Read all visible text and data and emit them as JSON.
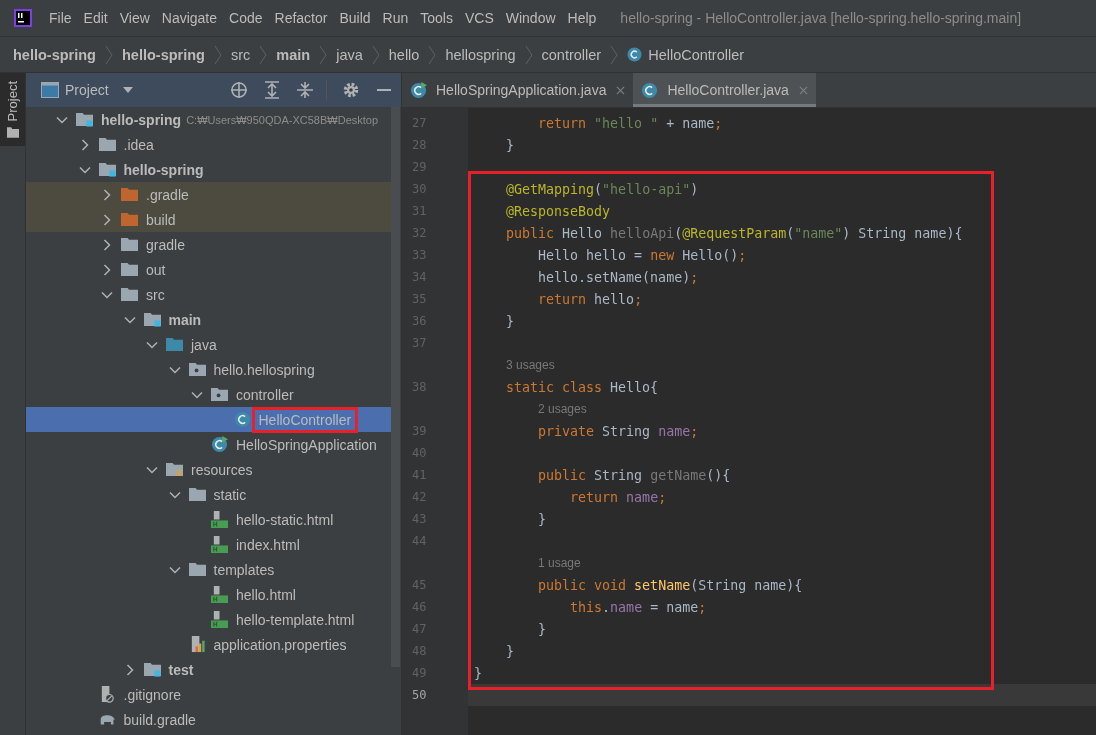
{
  "menu": [
    "File",
    "Edit",
    "View",
    "Navigate",
    "Code",
    "Refactor",
    "Build",
    "Run",
    "Tools",
    "VCS",
    "Window",
    "Help"
  ],
  "window": {
    "title": "hello-spring - HelloController.java [hello-spring.hello-spring.main]"
  },
  "breadcrumb": [
    {
      "label": "hello-spring",
      "bold": true
    },
    {
      "label": "hello-spring",
      "bold": true
    },
    {
      "label": "src",
      "bold": false
    },
    {
      "label": "main",
      "bold": true
    },
    {
      "label": "java",
      "bold": false
    },
    {
      "label": "hello",
      "bold": false
    },
    {
      "label": "hellospring",
      "bold": false
    },
    {
      "label": "controller",
      "bold": false
    },
    {
      "label": "HelloController",
      "bold": false,
      "kind": "class"
    }
  ],
  "side_tab": {
    "label": "Project"
  },
  "project_panel": {
    "title": "Project"
  },
  "tree": {
    "items": [
      {
        "name": "hello-spring",
        "kind": "module",
        "bold": true,
        "hint": "C:₩Users₩950QDA-XC58B₩Desktop",
        "expanded": true,
        "children": [
          {
            "name": ".idea",
            "kind": "folder",
            "expanded": false
          },
          {
            "name": "hello-spring",
            "kind": "module",
            "bold": true,
            "expanded": true,
            "children": [
              {
                "name": ".gradle",
                "kind": "excluded",
                "excluded": true,
                "expanded": false
              },
              {
                "name": "build",
                "kind": "excluded",
                "excluded": true,
                "expanded": false
              },
              {
                "name": "gradle",
                "kind": "folder",
                "expanded": false
              },
              {
                "name": "out",
                "kind": "folder",
                "expanded": false
              },
              {
                "name": "src",
                "kind": "folder",
                "expanded": true,
                "children": [
                  {
                    "name": "main",
                    "kind": "module",
                    "bold": true,
                    "expanded": true,
                    "children": [
                      {
                        "name": "java",
                        "kind": "source",
                        "expanded": true,
                        "children": [
                          {
                            "name": "hello.hellospring",
                            "kind": "package",
                            "expanded": true,
                            "children": [
                              {
                                "name": "controller",
                                "kind": "package",
                                "expanded": true,
                                "children": [
                                  {
                                    "name": "HelloController",
                                    "kind": "class",
                                    "selected": true,
                                    "boxed": true
                                  }
                                ]
                              },
                              {
                                "name": "HelloSpringApplication",
                                "kind": "app",
                                "selected": false
                              }
                            ]
                          }
                        ]
                      },
                      {
                        "name": "resources",
                        "kind": "resources",
                        "expanded": true,
                        "children": [
                          {
                            "name": "static",
                            "kind": "folder",
                            "expanded": true,
                            "children": [
                              {
                                "name": "hello-static.html",
                                "kind": "html"
                              },
                              {
                                "name": "index.html",
                                "kind": "html"
                              }
                            ]
                          },
                          {
                            "name": "templates",
                            "kind": "folder",
                            "expanded": true,
                            "children": [
                              {
                                "name": "hello.html",
                                "kind": "html"
                              },
                              {
                                "name": "hello-template.html",
                                "kind": "html"
                              }
                            ]
                          },
                          {
                            "name": "application.properties",
                            "kind": "properties"
                          }
                        ]
                      }
                    ]
                  },
                  {
                    "name": "test",
                    "kind": "module",
                    "bold": true,
                    "expanded": false
                  }
                ]
              }
            ]
          },
          {
            "name": ".gitignore",
            "kind": "gitignore"
          },
          {
            "name": "build.gradle",
            "kind": "gradle"
          }
        ]
      }
    ]
  },
  "tabs": [
    {
      "label": "HelloSpringApplication.java",
      "kind": "app",
      "selected": false
    },
    {
      "label": "HelloController.java",
      "kind": "class",
      "selected": true
    }
  ],
  "editor": {
    "blocks": [
      {
        "boxed": false,
        "lines": [
          {
            "number": "27",
            "tokens": [
              {
                "text": "        return ",
                "kind": "kw"
              },
              {
                "text": "\"hello \"",
                "kind": "str"
              },
              {
                "text": " + name",
                "kind": "plain"
              },
              {
                "text": ";",
                "kind": "kw"
              }
            ]
          },
          {
            "number": "28",
            "tokens": [
              {
                "text": "    }",
                "kind": "plain"
              }
            ]
          },
          {
            "number": "29"
          }
        ]
      },
      {
        "boxed": true,
        "lines": [
          {
            "number": "30",
            "tokens": [
              {
                "text": "    @GetMapping",
                "kind": "ann"
              },
              {
                "text": "(",
                "kind": "plain"
              },
              {
                "text": "\"hello-api\"",
                "kind": "str"
              },
              {
                "text": ")",
                "kind": "plain"
              }
            ]
          },
          {
            "number": "31",
            "tokens": [
              {
                "text": "    @ResponseBody",
                "kind": "ann"
              }
            ]
          },
          {
            "number": "32",
            "tokens": [
              {
                "text": "    public ",
                "kind": "kw"
              },
              {
                "text": "Hello ",
                "kind": "plain"
              },
              {
                "text": "helloApi",
                "kind": "unused"
              },
              {
                "text": "(",
                "kind": "plain"
              },
              {
                "text": "@RequestParam",
                "kind": "ann"
              },
              {
                "text": "(",
                "kind": "plain"
              },
              {
                "text": "\"name\"",
                "kind": "str"
              },
              {
                "text": ") String name){",
                "kind": "plain"
              }
            ]
          },
          {
            "number": "33",
            "tokens": [
              {
                "text": "        Hello hello = ",
                "kind": "plain"
              },
              {
                "text": "new ",
                "kind": "kw"
              },
              {
                "text": "Hello()",
                "kind": "plain"
              },
              {
                "text": ";",
                "kind": "kw"
              }
            ]
          },
          {
            "number": "34",
            "tokens": [
              {
                "text": "        hello.setName(name)",
                "kind": "plain"
              },
              {
                "text": ";",
                "kind": "kw"
              }
            ]
          },
          {
            "number": "35",
            "tokens": [
              {
                "text": "        return ",
                "kind": "kw"
              },
              {
                "text": "hello",
                "kind": "plain"
              },
              {
                "text": ";",
                "kind": "kw"
              }
            ]
          },
          {
            "number": "36",
            "tokens": [
              {
                "text": "    }",
                "kind": "plain"
              }
            ]
          },
          {
            "number": "37"
          },
          {
            "kind": "hint",
            "text": "3 usages"
          },
          {
            "number": "38",
            "tokens": [
              {
                "text": "    static class ",
                "kind": "kw"
              },
              {
                "text": "Hello{",
                "kind": "plain"
              }
            ]
          },
          {
            "kind": "hint",
            "text": "2 usages"
          },
          {
            "number": "39",
            "tokens": [
              {
                "text": "        private ",
                "kind": "kw"
              },
              {
                "text": "String ",
                "kind": "plain"
              },
              {
                "text": "name",
                "kind": "field"
              },
              {
                "text": ";",
                "kind": "kw"
              }
            ]
          },
          {
            "number": "40"
          },
          {
            "number": "41",
            "tokens": [
              {
                "text": "        public ",
                "kind": "kw"
              },
              {
                "text": "String ",
                "kind": "plain"
              },
              {
                "text": "getName",
                "kind": "unused"
              },
              {
                "text": "(){",
                "kind": "plain"
              }
            ]
          },
          {
            "number": "42",
            "tokens": [
              {
                "text": "            return ",
                "kind": "kw"
              },
              {
                "text": "name",
                "kind": "field"
              },
              {
                "text": ";",
                "kind": "kw"
              }
            ]
          },
          {
            "number": "43",
            "tokens": [
              {
                "text": "        }",
                "kind": "plain"
              }
            ]
          },
          {
            "number": "44"
          },
          {
            "kind": "hint",
            "text": "1 usage"
          },
          {
            "number": "45",
            "tokens": [
              {
                "text": "        public void ",
                "kind": "kw"
              },
              {
                "text": "setName",
                "kind": "fn"
              },
              {
                "text": "(String name){",
                "kind": "plain"
              }
            ]
          },
          {
            "number": "46",
            "tokens": [
              {
                "text": "            this",
                "kind": "kw"
              },
              {
                "text": ".",
                "kind": "plain"
              },
              {
                "text": "name",
                "kind": "field"
              },
              {
                "text": " = name",
                "kind": "plain"
              },
              {
                "text": ";",
                "kind": "kw"
              }
            ]
          },
          {
            "number": "47",
            "tokens": [
              {
                "text": "        }",
                "kind": "plain"
              }
            ]
          },
          {
            "number": "48",
            "tokens": [
              {
                "text": "    }",
                "kind": "plain"
              }
            ]
          },
          {
            "number": "49",
            "tokens": [
              {
                "text": "}",
                "kind": "plain"
              }
            ]
          }
        ]
      },
      {
        "boxed": false,
        "lines": [
          {
            "number": "50",
            "current": true
          }
        ]
      }
    ]
  }
}
